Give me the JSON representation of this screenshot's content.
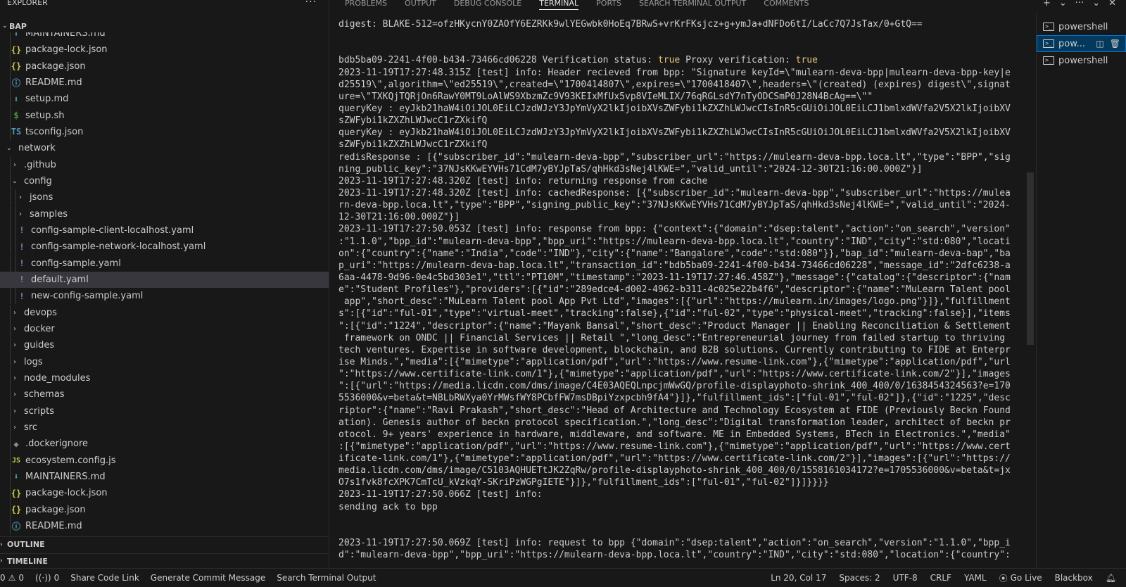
{
  "sidebar": {
    "explorer_title": "EXPLORER",
    "more_label": "···",
    "workspace": "BAP",
    "outline": "OUTLINE",
    "timeline": "TIMELINE",
    "tree": [
      {
        "label": "MAINTAINERS.md",
        "icon": "md",
        "glyph": "⬇",
        "depth": 1,
        "type": "file",
        "partial": true
      },
      {
        "label": "package-lock.json",
        "icon": "json",
        "glyph": "{}",
        "depth": 1,
        "type": "file"
      },
      {
        "label": "package.json",
        "icon": "json",
        "glyph": "{}",
        "depth": 1,
        "type": "file"
      },
      {
        "label": "README.md",
        "icon": "info",
        "glyph": "ⓘ",
        "depth": 1,
        "type": "file"
      },
      {
        "label": "setup.md",
        "icon": "md",
        "glyph": "⬇",
        "depth": 1,
        "type": "file"
      },
      {
        "label": "setup.sh",
        "icon": "sh",
        "glyph": "$",
        "depth": 1,
        "type": "file"
      },
      {
        "label": "tsconfig.json",
        "icon": "ts",
        "glyph": "TS",
        "depth": 1,
        "type": "file"
      },
      {
        "label": "network",
        "depth": 0,
        "type": "folder",
        "open": true
      },
      {
        "label": ".github",
        "depth": 1,
        "type": "folder",
        "open": false
      },
      {
        "label": "config",
        "depth": 1,
        "type": "folder",
        "open": true
      },
      {
        "label": "jsons",
        "depth": 2,
        "type": "folder",
        "open": false
      },
      {
        "label": "samples",
        "depth": 2,
        "type": "folder",
        "open": false
      },
      {
        "label": "config-sample-client-localhost.yaml",
        "icon": "yaml",
        "glyph": "!",
        "depth": 2,
        "type": "file"
      },
      {
        "label": "config-sample-network-localhost.yaml",
        "icon": "yaml",
        "glyph": "!",
        "depth": 2,
        "type": "file"
      },
      {
        "label": "config-sample.yaml",
        "icon": "yaml",
        "glyph": "!",
        "depth": 2,
        "type": "file"
      },
      {
        "label": "default.yaml",
        "icon": "yaml",
        "glyph": "!",
        "depth": 2,
        "type": "file",
        "selected": true
      },
      {
        "label": "new-config-sample.yaml",
        "icon": "yaml",
        "glyph": "!",
        "depth": 2,
        "type": "file"
      },
      {
        "label": "devops",
        "depth": 1,
        "type": "folder",
        "open": false
      },
      {
        "label": "docker",
        "depth": 1,
        "type": "folder",
        "open": false
      },
      {
        "label": "guides",
        "depth": 1,
        "type": "folder",
        "open": false
      },
      {
        "label": "logs",
        "depth": 1,
        "type": "folder",
        "open": false
      },
      {
        "label": "node_modules",
        "depth": 1,
        "type": "folder",
        "open": false
      },
      {
        "label": "schemas",
        "depth": 1,
        "type": "folder",
        "open": false
      },
      {
        "label": "scripts",
        "depth": 1,
        "type": "folder",
        "open": false
      },
      {
        "label": "src",
        "depth": 1,
        "type": "folder",
        "open": false
      },
      {
        "label": ".dockerignore",
        "icon": "docker",
        "glyph": "◆",
        "depth": 1,
        "type": "file"
      },
      {
        "label": "ecosystem.config.js",
        "icon": "js",
        "glyph": "JS",
        "depth": 1,
        "type": "file"
      },
      {
        "label": "MAINTAINERS.md",
        "icon": "md",
        "glyph": "⬇",
        "depth": 1,
        "type": "file"
      },
      {
        "label": "package-lock.json",
        "icon": "json",
        "glyph": "{}",
        "depth": 1,
        "type": "file"
      },
      {
        "label": "package.json",
        "icon": "json",
        "glyph": "{}",
        "depth": 1,
        "type": "file"
      },
      {
        "label": "README.md",
        "icon": "info",
        "glyph": "ⓘ",
        "depth": 1,
        "type": "file",
        "partial": true
      }
    ]
  },
  "panel": {
    "tabs": [
      {
        "label": "PROBLEMS",
        "active": false
      },
      {
        "label": "OUTPUT",
        "active": false
      },
      {
        "label": "DEBUG CONSOLE",
        "active": false
      },
      {
        "label": "TERMINAL",
        "active": true
      },
      {
        "label": "PORTS",
        "active": false
      },
      {
        "label": "SEARCH TERMINAL OUTPUT",
        "active": false
      },
      {
        "label": "COMMENTS",
        "active": false
      }
    ],
    "actions": [
      "+",
      "⌄",
      "···",
      "⌄",
      "✕"
    ],
    "terminals": [
      {
        "label": "powershell",
        "active": false
      },
      {
        "label": "pow...",
        "active": true
      },
      {
        "label": "powershell",
        "active": false
      }
    ],
    "terminal_lines": [
      "digest: BLAKE-512=ofzHKycnY0ZAOfY6EZRKk9wlYEGwbk0HoEq7BRwS+vrKrFKsjcz+g+ymJa+dNFDo6tI/LaCc7Q7JsTax/0+GtQ==",
      "",
      "",
      "bdb5ba09-2241-4f00-b434-73466cd06228 Verification status: true Proxy verification: true",
      "2023-11-19T17:27:48.315Z [test] info: Header recieved from bpp: \"Signature keyId=\\\"mulearn-deva-bpp|mulearn-deva-bpp-key|e",
      "d25519\\\",algorithm=\\\"ed25519\\\",created=\\\"1700414807\\\",expires=\\\"1700418407\\\",headers=\\\"(created) (expires) digest\\\",signat",
      "ure=\\\"TXKQjTQRjOn6RawY0MT9LoAlWS9XbzmZc9V93KEIxMfUx5vp8VIeMLIX/76qRGLsdY7nTyODCSmP0J28N4BcAg==\\\"\"",
      "queryKey : eyJkb21haW4iOiJOL0EiLCJzdWJzY3JpYmVyX2lkIjoibXVsZWFybi1kZXZhLWJwcCIsInR5cGUiOiJOL0EiLCJ1bmlxdWVfa2V5X2lkIjoibXV",
      "sZWFybi1kZXZhLWJwcC1rZXkifQ",
      "queryKey : eyJkb21haW4iOiJOL0EiLCJzdWJzY3JpYmVyX2lkIjoibXVsZWFybi1kZXZhLWJwcCIsInR5cGUiOiJOL0EiLCJ1bmlxdWVfa2V5X2lkIjoibXV",
      "sZWFybi1kZXZhLWJwcC1rZXkifQ",
      "redisResponse : [{\"subscriber_id\":\"mulearn-deva-bpp\",\"subscriber_url\":\"https://mulearn-deva-bpp.loca.lt\",\"type\":\"BPP\",\"sig",
      "ning_public_key\":\"37NJsKKwEYVHs71CdM7yBYJpTaS/qhHkd3sNej4lKWE=\",\"valid_until\":\"2024-12-30T21:16:00.000Z\"}]",
      "2023-11-19T17:27:48.320Z [test] info: returning response from cache",
      "2023-11-19T17:27:48.320Z [test] info: cachedResponse: [{\"subscriber_id\":\"mulearn-deva-bpp\",\"subscriber_url\":\"https://mulea",
      "rn-deva-bpp.loca.lt\",\"type\":\"BPP\",\"signing_public_key\":\"37NJsKKwEYVHs71CdM7yBYJpTaS/qhHkd3sNej4lKWE=\",\"valid_until\":\"2024-",
      "12-30T21:16:00.000Z\"}]",
      "2023-11-19T17:27:50.053Z [test] info: response from bpp: {\"context\":{\"domain\":\"dsep:talent\",\"action\":\"on_search\",\"version\"",
      ":\"1.1.0\",\"bpp_id\":\"mulearn-deva-bpp\",\"bpp_uri\":\"https://mulearn-deva-bpp.loca.lt\",\"country\":\"IND\",\"city\":\"std:080\",\"locati",
      "on\":{\"country\":{\"name\":\"India\",\"code\":\"IND\"},\"city\":{\"name\":\"Bangalore\",\"code\":\"std:080\"}},\"bap_id\":\"mulearn-deva-bap\",\"ba",
      "p_uri\":\"https://mulearn-deva-bap.loca.lt\",\"transaction_id\":\"bdb5ba09-2241-4f00-b434-73466cd06228\",\"message_id\":\"2dfc6238-a",
      "6aa-4478-9d96-0e4c5bd303e1\",\"ttl\":\"PT10M\",\"timestamp\":\"2023-11-19T17:27:46.458Z\"},\"message\":{\"catalog\":{\"descriptor\":{\"nam",
      "e\":\"Student Profiles\"},\"providers\":[{\"id\":\"289edce4-d002-4962-b311-4c025e22b4f6\",\"descriptor\":{\"name\":\"MuLearn Talent pool",
      " app\",\"short_desc\":\"MuLearn Talent pool App Pvt Ltd\",\"images\":[{\"url\":\"https://mulearn.in/images/logo.png\"}]},\"fulfillment",
      "s\":[{\"id\":\"ful-01\",\"type\":\"virtual-meet\",\"tracking\":false},{\"id\":\"ful-02\",\"type\":\"physical-meet\",\"tracking\":false}],\"items",
      "\":[{\"id\":\"1224\",\"descriptor\":{\"name\":\"Mayank Bansal\",\"short_desc\":\"Product Manager || Enabling Reconciliation & Settlement",
      " framework on ONDC || Financial Services || Retail \",\"long_desc\":\"Entrepreneurial journey from failed startup to thriving",
      "tech ventures. Expertise in software development, blockchain, and B2B solutions. Currently contributing to FIDE at Enterpr",
      "ise Minds.\",\"media\":[{\"mimetype\":\"application/pdf\",\"url\":\"https://www.resume-link.com\"},{\"mimetype\":\"application/pdf\",\"url",
      "\":\"https://www.certificate-link.com/1\"},{\"mimetype\":\"application/pdf\",\"url\":\"https://www.certificate-link.com/2\"}],\"images",
      "\":[{\"url\":\"https://media.licdn.com/dms/image/C4E03AQEQLnpcjmWwGQ/profile-displayphoto-shrink_400_400/0/1638454324563?e=170",
      "5536000&v=beta&t=NBLbRWXya0YrMWsfWY8PCbfFW7msDBpiYzxpcbh9fA4\"}]},\"fulfillment_ids\":[\"ful-01\",\"ful-02\"]},{\"id\":\"1225\",\"desc",
      "riptor\":{\"name\":\"Ravi Prakash\",\"short_desc\":\"Head of Architecture and Technology Ecosystem at FIDE (Previously Beckn Found",
      "ation). Genesis author of beckn protocol specification.\",\"long_desc\":\"Digital transformation leader, architect of beckn pr",
      "otocol. 9+ years' experience in hardware, middleware, and software. ME in Embedded Systems, BTech in Electronics.\",\"media\"",
      ":[{\"mimetype\":\"application/pdf\",\"url\":\"https://www.resume-link.com\"},{\"mimetype\":\"application/pdf\",\"url\":\"https://www.cert",
      "ificate-link.com/1\"},{\"mimetype\":\"application/pdf\",\"url\":\"https://www.certificate-link.com/2\"}],\"images\":[{\"url\":\"https://",
      "media.licdn.com/dms/image/C5103AQHUETtJK2ZqRw/profile-displayphoto-shrink_400_400/0/1558161034172?e=1705536000&v=beta&t=jx",
      "O7s1fvk8fcXPK7CmTcU_kVzkqY-SKriPzWGPgIETE\"}]},\"fulfillment_ids\":[\"ful-01\",\"ful-02\"]}]}}}}",
      "2023-11-19T17:27:50.066Z [test] info:",
      "sending ack to bpp",
      "",
      "",
      "2023-11-19T17:27:50.069Z [test] info: request to bpp {\"domain\":\"dsep:talent\",\"action\":\"on_search\",\"version\":\"1.1.0\",\"bpp_i",
      "d\":\"mulearn-deva-bpp\",\"bpp_uri\":\"https://mulearn-deva-bpp.loca.lt\",\"country\":\"IND\",\"city\":\"std:080\",\"location\":{\"country\":"
    ]
  },
  "statusbar": {
    "errors": "0",
    "warnings": "0",
    "ports": "0",
    "share": "Share Code Link",
    "commit": "Generate Commit Message",
    "search": "Search Terminal Output",
    "position": "Ln 20, Col 17",
    "spaces": "Spaces: 2",
    "encoding": "UTF-8",
    "eol": "CRLF",
    "language": "YAML",
    "golive": "Go Live",
    "blackbox": "Blackbox"
  }
}
